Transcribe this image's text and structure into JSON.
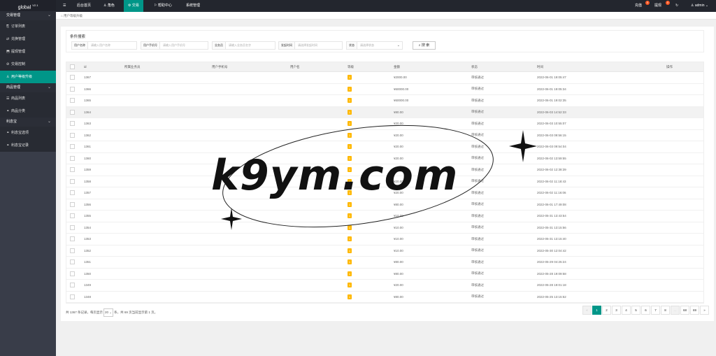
{
  "app": {
    "brand": "global",
    "version": "V2.1"
  },
  "topnav": {
    "menu_icon": "menu-icon",
    "items": [
      {
        "label": "后台首页"
      },
      {
        "label": "角色",
        "icon": "user-icon"
      },
      {
        "label": "交易",
        "icon": "trade-icon"
      },
      {
        "label": "帮助中心",
        "icon": "help-icon"
      },
      {
        "label": "系统管理"
      }
    ],
    "right": [
      {
        "label": "充值",
        "badge": "0"
      },
      {
        "label": "提现",
        "badge": "0"
      }
    ],
    "user": "admin"
  },
  "sidebar": {
    "groups": [
      {
        "label": "交易管理",
        "items": [
          "订单列表",
          "兑换管理",
          "提现管理",
          "交易控制",
          "用户等级升级"
        ]
      },
      {
        "label": "商品管理",
        "items": [
          "商品列表",
          "商品分类"
        ]
      },
      {
        "label": "利息宝",
        "items": [
          "利息宝选项",
          "利息宝记录"
        ]
      }
    ],
    "active": "用户等级升级"
  },
  "breadcrumb": "用户等级升级",
  "filter": {
    "legend": "条件搜索",
    "fields": [
      {
        "label": "用户名称",
        "placeholder": "请输入用户名称"
      },
      {
        "label": "用户手机号",
        "placeholder": "请输入用户手机号"
      },
      {
        "label": "业务员",
        "placeholder": "请输入业务员名字"
      },
      {
        "label": "发起时间",
        "placeholder": "请选择发起时间"
      },
      {
        "label": "状态",
        "placeholder": "请选择状态"
      }
    ],
    "search_label": "搜 索"
  },
  "table": {
    "columns": [
      "id",
      "所属业务员",
      "用户手机号",
      "用户名",
      "等级",
      "金额",
      "状态",
      "时间",
      "操作"
    ],
    "rows": [
      {
        "id": "1367",
        "level": "1",
        "amount": "¥2000.00",
        "status": "审核通过",
        "time": "2022-06-01 19:05:47"
      },
      {
        "id": "1366",
        "level": "1",
        "amount": "¥60000.00",
        "status": "审核通过",
        "time": "2022-06-01 19:05:34"
      },
      {
        "id": "1365",
        "level": "1",
        "amount": "¥60000.00",
        "status": "审核通过",
        "time": "2022-06-01 19:02:35"
      },
      {
        "id": "1364",
        "level": "1",
        "amount": "¥80.00",
        "status": "审核通过",
        "time": "2022-06-03 14:52:33"
      },
      {
        "id": "1363",
        "level": "1",
        "amount": "¥20.00",
        "status": "审核通过",
        "time": "2022-06-03 10:55:07"
      },
      {
        "id": "1362",
        "level": "1",
        "amount": "¥20.00",
        "status": "审核通过",
        "time": "2022-06-03 09:56:15"
      },
      {
        "id": "1361",
        "level": "1",
        "amount": "¥20.00",
        "status": "审核通过",
        "time": "2022-06-03 09:54:04"
      },
      {
        "id": "1360",
        "level": "1",
        "amount": "¥20.00",
        "status": "审核通过",
        "time": "2022-06-02 13:59:55"
      },
      {
        "id": "1359",
        "level": "1",
        "amount": "¥20.00",
        "status": "审核通过",
        "time": "2022-06-02 12:38:39"
      },
      {
        "id": "1358",
        "level": "1",
        "amount": "¥20.00",
        "status": "审核通过",
        "time": "2022-06-02 11:18:43"
      },
      {
        "id": "1357",
        "level": "1",
        "amount": "¥20.00",
        "status": "审核通过",
        "time": "2022-06-02 11:16:06"
      },
      {
        "id": "1356",
        "level": "1",
        "amount": "¥80.00",
        "status": "审核通过",
        "time": "2022-06-01 17:49:08"
      },
      {
        "id": "1355",
        "level": "1",
        "amount": "¥10.00",
        "status": "审核通过",
        "time": "2022-05-31 13:43:54"
      },
      {
        "id": "1354",
        "level": "1",
        "amount": "¥10.00",
        "status": "审核通过",
        "time": "2022-05-31 13:15:56"
      },
      {
        "id": "1353",
        "level": "1",
        "amount": "¥10.00",
        "status": "审核通过",
        "time": "2022-05-31 13:15:40"
      },
      {
        "id": "1352",
        "level": "1",
        "amount": "¥10.00",
        "status": "审核通过",
        "time": "2022-05-30 12:04:42"
      },
      {
        "id": "1351",
        "level": "1",
        "amount": "¥80.00",
        "status": "审核通过",
        "time": "2022-05-29 04:25:24"
      },
      {
        "id": "1350",
        "level": "1",
        "amount": "¥80.00",
        "status": "审核通过",
        "time": "2022-05-28 19:09:58"
      },
      {
        "id": "1349",
        "level": "1",
        "amount": "¥20.00",
        "status": "审核通过",
        "time": "2022-05-28 19:01:18"
      },
      {
        "id": "1348",
        "level": "1",
        "amount": "¥80.00",
        "status": "审核通过",
        "time": "2022-05-25 13:15:52"
      }
    ]
  },
  "pagination": {
    "info_prefix": "共 1367 条记录，每页显示",
    "page_size": "20",
    "info_suffix": "条，共 69 页当前显示第 1 页。",
    "prev": "«",
    "next": "»",
    "pages": [
      "1",
      "2",
      "3",
      "4",
      "5",
      "6",
      "7",
      "8",
      "…",
      "68",
      "69"
    ]
  },
  "watermark": "k9ym.com"
}
